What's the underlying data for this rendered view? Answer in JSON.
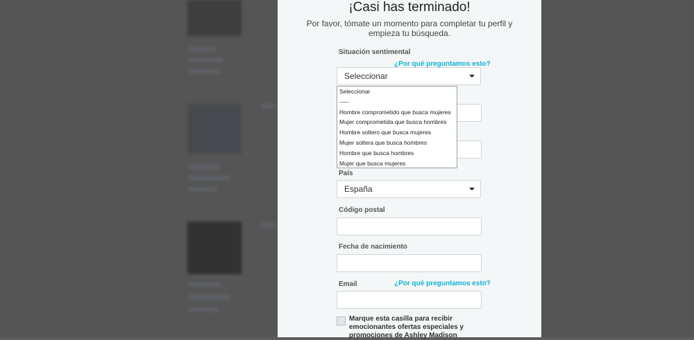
{
  "modal": {
    "title": "¡Casi has terminado!",
    "subtitle": "Por favor, tómate un momento para completar tu perfil y empieza tu búsqueda.",
    "why_link": "¿Por qué preguntamos esto?"
  },
  "form": {
    "relationship": {
      "label": "Situación sentimental",
      "value": "Seleccionar",
      "options": [
        "Seleccionar",
        "-----",
        "Hombre comprometido que busca mujeres",
        "Mujer comprometida que busca hombres",
        "Hombre soltero que busca mujeres",
        "Mujer soltera que busca hombres",
        "Hombre que busca hombres",
        "Mujer que busca mujeres"
      ]
    },
    "country": {
      "label": "País",
      "value": "España"
    },
    "postal": {
      "label": "Código postal",
      "value": ""
    },
    "birthdate": {
      "label": "Fecha de nacimiento",
      "value": ""
    },
    "email": {
      "label": "Email",
      "value": ""
    },
    "offers_checkbox": {
      "label": "Marque esta casilla para recibir emocionantes ofertas especiales y promociones de Ashley Madison",
      "checked": false
    }
  },
  "colors": {
    "link": "#0fb3d5",
    "modal_bg": "#f4f7f8",
    "backdrop": "#5e5e5e"
  }
}
